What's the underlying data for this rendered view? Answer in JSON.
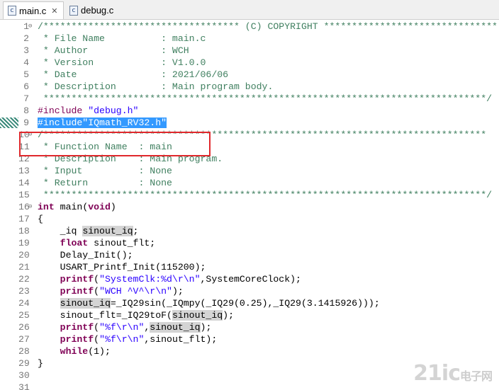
{
  "tabs": [
    {
      "label": "main.c",
      "icon": "c-file-icon",
      "close": "✕",
      "active": true
    },
    {
      "label": "debug.c",
      "icon": "c-file-icon",
      "active": false
    }
  ],
  "watermark": {
    "brand": "21ic",
    "sub": "电子网"
  },
  "lines": [
    {
      "n": "1",
      "fold": "⊖",
      "segs": [
        {
          "t": "/*********************************** (C) COPYRIGHT *******************************",
          "c": "cm"
        }
      ]
    },
    {
      "n": "2",
      "segs": [
        {
          "t": " * File Name          : main.c",
          "c": "cm"
        }
      ]
    },
    {
      "n": "3",
      "segs": [
        {
          "t": " * Author             : WCH",
          "c": "cm"
        }
      ]
    },
    {
      "n": "4",
      "segs": [
        {
          "t": " * Version            : V1.0.0",
          "c": "cm"
        }
      ]
    },
    {
      "n": "5",
      "segs": [
        {
          "t": " * Date               : 2021/06/06",
          "c": "cm"
        }
      ]
    },
    {
      "n": "6",
      "segs": [
        {
          "t": " * Description        : Main program body.",
          "c": "cm"
        }
      ]
    },
    {
      "n": "7",
      "segs": [
        {
          "t": " *******************************************************************************/",
          "c": "cm"
        }
      ]
    },
    {
      "n": "8",
      "segs": [
        {
          "t": "#include ",
          "c": "pp"
        },
        {
          "t": "\"debug.h\"",
          "c": "str"
        }
      ]
    },
    {
      "n": "9",
      "marker": true,
      "segs": [
        {
          "t": "#include\"IQmath_RV32.h\"",
          "c": "sel"
        }
      ]
    },
    {
      "n": "10",
      "fold": "⊖",
      "segs": [
        {
          "t": "/*******************************************************************************",
          "c": "cm"
        }
      ]
    },
    {
      "n": "11",
      "segs": [
        {
          "t": " * Function Name  : main",
          "c": "cm"
        }
      ]
    },
    {
      "n": "12",
      "segs": [
        {
          "t": " * Description    : Main program.",
          "c": "cm"
        }
      ]
    },
    {
      "n": "13",
      "segs": [
        {
          "t": " * Input          : None",
          "c": "cm"
        }
      ]
    },
    {
      "n": "14",
      "segs": [
        {
          "t": " * Return         : None",
          "c": "cm"
        }
      ]
    },
    {
      "n": "15",
      "segs": [
        {
          "t": " *******************************************************************************/",
          "c": "cm"
        }
      ]
    },
    {
      "n": "16",
      "fold": "⊖",
      "segs": [
        {
          "t": "int",
          "c": "kw"
        },
        {
          "t": " "
        },
        {
          "t": "main",
          "c": "b"
        },
        {
          "t": "("
        },
        {
          "t": "void",
          "c": "kw"
        },
        {
          "t": ")"
        }
      ]
    },
    {
      "n": "17",
      "segs": [
        {
          "t": "{"
        }
      ]
    },
    {
      "n": "18",
      "segs": [
        {
          "t": "    _iq "
        },
        {
          "t": "sinout_iq",
          "c": "hl"
        },
        {
          "t": ";"
        }
      ]
    },
    {
      "n": "19",
      "segs": [
        {
          "t": "    "
        },
        {
          "t": "float",
          "c": "kw"
        },
        {
          "t": " sinout_flt;"
        }
      ]
    },
    {
      "n": "20",
      "segs": [
        {
          "t": "    Delay_Init();"
        }
      ]
    },
    {
      "n": "21",
      "segs": [
        {
          "t": "    USART_Printf_Init(115200);"
        }
      ]
    },
    {
      "n": "22",
      "segs": [
        {
          "t": "    printf(",
          "c": "pfn"
        },
        {
          "t": "\"SystemClk:%d\\r\\n\"",
          "c": "str"
        },
        {
          "t": ",SystemCoreClock);"
        }
      ]
    },
    {
      "n": "23",
      "segs": [
        {
          "t": "    printf(",
          "c": "pfn"
        },
        {
          "t": "\"WCH ^V^\\r\\n\"",
          "c": "str"
        },
        {
          "t": ");"
        }
      ]
    },
    {
      "n": "24",
      "segs": [
        {
          "t": "    "
        },
        {
          "t": "sinout_iq",
          "c": "hl"
        },
        {
          "t": "=_IQ29sin(_IQmpy(_IQ29(0.25),_IQ29(3.1415926)));"
        }
      ]
    },
    {
      "n": "25",
      "segs": [
        {
          "t": "    sinout_flt=_IQ29toF("
        },
        {
          "t": "sinout_iq",
          "c": "hl"
        },
        {
          "t": ");"
        }
      ]
    },
    {
      "n": "26",
      "segs": [
        {
          "t": "    printf(",
          "c": "pfn"
        },
        {
          "t": "\"%f\\r\\n\"",
          "c": "str"
        },
        {
          "t": ","
        },
        {
          "t": "sinout_iq",
          "c": "hl"
        },
        {
          "t": ");"
        }
      ]
    },
    {
      "n": "27",
      "segs": [
        {
          "t": "    printf(",
          "c": "pfn"
        },
        {
          "t": "\"%f\\r\\n\"",
          "c": "str"
        },
        {
          "t": ",sinout_flt);"
        }
      ]
    },
    {
      "n": "28",
      "segs": [
        {
          "t": "    "
        },
        {
          "t": "while",
          "c": "kw"
        },
        {
          "t": "(1);"
        }
      ]
    },
    {
      "n": "29",
      "segs": [
        {
          "t": "}"
        }
      ]
    },
    {
      "n": "30",
      "segs": []
    },
    {
      "n": "31",
      "segs": []
    }
  ]
}
